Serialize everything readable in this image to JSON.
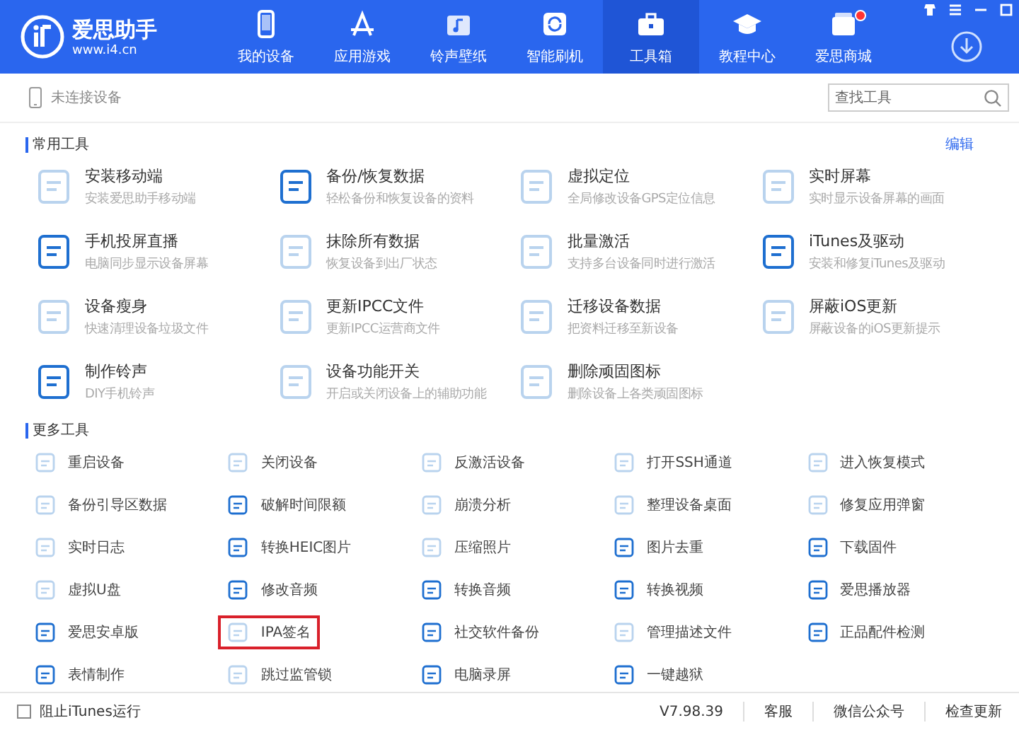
{
  "app": {
    "name": "爱思助手",
    "url": "www.i4.cn"
  },
  "nav": [
    {
      "label": "我的设备",
      "selected": false,
      "badge": false
    },
    {
      "label": "应用游戏",
      "selected": false,
      "badge": false
    },
    {
      "label": "铃声壁纸",
      "selected": false,
      "badge": false
    },
    {
      "label": "智能刷机",
      "selected": false,
      "badge": false
    },
    {
      "label": "工具箱",
      "selected": true,
      "badge": false
    },
    {
      "label": "教程中心",
      "selected": false,
      "badge": false
    },
    {
      "label": "爱思商城",
      "selected": false,
      "badge": true
    }
  ],
  "device": {
    "status": "未连接设备"
  },
  "search": {
    "placeholder": "查找工具"
  },
  "common_tools": {
    "title": "常用工具",
    "edit": "编辑",
    "items": [
      {
        "name": "安装移动端",
        "desc": "安装爱思助手移动端",
        "active": false
      },
      {
        "name": "备份/恢复数据",
        "desc": "轻松备份和恢复设备的资料",
        "active": true
      },
      {
        "name": "虚拟定位",
        "desc": "全局修改设备GPS定位信息",
        "active": false
      },
      {
        "name": "实时屏幕",
        "desc": "实时显示设备屏幕的画面",
        "active": false
      },
      {
        "name": "手机投屏直播",
        "desc": "电脑同步显示设备屏幕",
        "active": true
      },
      {
        "name": "抹除所有数据",
        "desc": "恢复设备到出厂状态",
        "active": false
      },
      {
        "name": "批量激活",
        "desc": "支持多台设备同时进行激活",
        "active": false
      },
      {
        "name": "iTunes及驱动",
        "desc": "安装和修复iTunes及驱动",
        "active": true
      },
      {
        "name": "设备瘦身",
        "desc": "快速清理设备垃圾文件",
        "active": false
      },
      {
        "name": "更新IPCC文件",
        "desc": "更新IPCC运营商文件",
        "active": false
      },
      {
        "name": "迁移设备数据",
        "desc": "把资料迁移至新设备",
        "active": false
      },
      {
        "name": "屏蔽iOS更新",
        "desc": "屏蔽设备的iOS更新提示",
        "active": false
      },
      {
        "name": "制作铃声",
        "desc": "DIY手机铃声",
        "active": true
      },
      {
        "name": "设备功能开关",
        "desc": "开启或关闭设备上的辅助功能",
        "active": false
      },
      {
        "name": "删除顽固图标",
        "desc": "删除设备上各类顽固图标",
        "active": false
      }
    ]
  },
  "more_tools": {
    "title": "更多工具",
    "items": [
      {
        "name": "重启设备",
        "active": false,
        "highlighted": false
      },
      {
        "name": "关闭设备",
        "active": false,
        "highlighted": false
      },
      {
        "name": "反激活设备",
        "active": false,
        "highlighted": false
      },
      {
        "name": "打开SSH通道",
        "active": false,
        "highlighted": false
      },
      {
        "name": "进入恢复模式",
        "active": false,
        "highlighted": false
      },
      {
        "name": "备份引导区数据",
        "active": false,
        "highlighted": false
      },
      {
        "name": "破解时间限额",
        "active": true,
        "highlighted": false
      },
      {
        "name": "崩溃分析",
        "active": false,
        "highlighted": false
      },
      {
        "name": "整理设备桌面",
        "active": false,
        "highlighted": false
      },
      {
        "name": "修复应用弹窗",
        "active": false,
        "highlighted": false
      },
      {
        "name": "实时日志",
        "active": false,
        "highlighted": false
      },
      {
        "name": "转换HEIC图片",
        "active": true,
        "highlighted": false
      },
      {
        "name": "压缩照片",
        "active": false,
        "highlighted": false
      },
      {
        "name": "图片去重",
        "active": true,
        "highlighted": false
      },
      {
        "name": "下载固件",
        "active": true,
        "highlighted": false
      },
      {
        "name": "虚拟U盘",
        "active": false,
        "highlighted": false
      },
      {
        "name": "修改音频",
        "active": true,
        "highlighted": false
      },
      {
        "name": "转换音频",
        "active": true,
        "highlighted": false
      },
      {
        "name": "转换视频",
        "active": true,
        "highlighted": false
      },
      {
        "name": "爱思播放器",
        "active": true,
        "highlighted": false
      },
      {
        "name": "爱思安卓版",
        "active": true,
        "highlighted": false
      },
      {
        "name": "IPA签名",
        "active": false,
        "highlighted": true
      },
      {
        "name": "社交软件备份",
        "active": true,
        "highlighted": false
      },
      {
        "name": "管理描述文件",
        "active": false,
        "highlighted": false
      },
      {
        "name": "正品配件检测",
        "active": true,
        "highlighted": false
      },
      {
        "name": "表情制作",
        "active": true,
        "highlighted": false
      },
      {
        "name": "跳过监管锁",
        "active": false,
        "highlighted": false
      },
      {
        "name": "电脑录屏",
        "active": true,
        "highlighted": false
      },
      {
        "name": "一键越狱",
        "active": true,
        "highlighted": false
      }
    ]
  },
  "footer": {
    "block_itunes": {
      "label": "阻止iTunes运行",
      "checked": false
    },
    "version": "V7.98.39",
    "links": [
      "客服",
      "微信公众号",
      "检查更新"
    ]
  }
}
